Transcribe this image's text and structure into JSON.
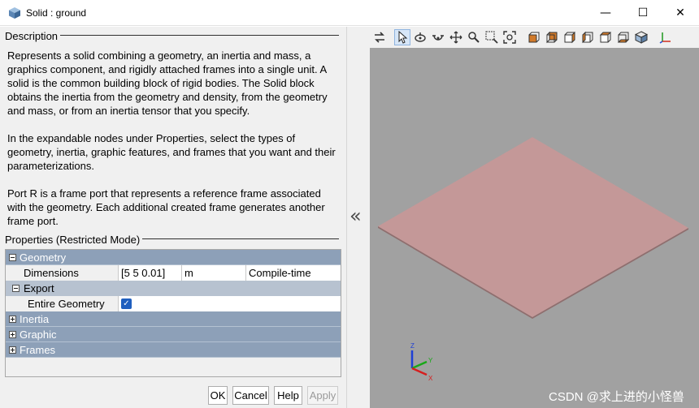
{
  "window": {
    "title": "Solid : ground",
    "minimize_glyph": "—",
    "maximize_glyph": "☐",
    "close_glyph": "✕"
  },
  "description": {
    "heading": "Description",
    "paragraphs": [
      "Represents a solid combining a geometry, an inertia and mass, a graphics component, and rigidly attached frames into a single unit. A solid is the common building block of rigid bodies. The Solid block obtains the inertia from the geometry and density, from the geometry and mass, or from an inertia tensor that you specify.",
      "In the expandable nodes under Properties, select the types of geometry, inertia, graphic features, and frames that you want and their parameterizations.",
      "Port R is a frame port that represents a reference frame associated with the geometry. Each additional created frame generates another frame port."
    ]
  },
  "properties": {
    "heading": "Properties (Restricted Mode)",
    "geometry": {
      "label": "Geometry",
      "expanded": true
    },
    "dimensions": {
      "label": "Dimensions",
      "value": "[5 5 0.01]",
      "unit": "m",
      "mode": "Compile-time"
    },
    "export": {
      "label": "Export",
      "expanded": true
    },
    "entire_geometry": {
      "label": "Entire Geometry",
      "checked": true,
      "check_glyph": "✓"
    },
    "inertia": {
      "label": "Inertia",
      "expanded": false
    },
    "graphic": {
      "label": "Graphic",
      "expanded": false
    },
    "frames": {
      "label": "Frames",
      "expanded": false
    }
  },
  "buttons": {
    "ok": "OK",
    "cancel": "Cancel",
    "help": "Help",
    "apply": "Apply"
  },
  "splitter": {
    "collapse_glyph": "«"
  },
  "viewer": {
    "toolbar_icons": [
      "swap-arrows-icon",
      "select-pointer-icon",
      "rotate-icon",
      "roll-icon",
      "pan-icon",
      "zoom-icon",
      "zoom-box-icon",
      "fit-view-icon",
      "front-view-icon",
      "back-view-icon",
      "left-view-icon",
      "right-view-icon",
      "top-view-icon",
      "bottom-view-icon",
      "isometric-view-icon",
      "frame-axes-icon"
    ],
    "background_color": "#a1a1a1",
    "solid_color": "#c49898",
    "triad": {
      "x": "X",
      "y": "Y",
      "z": "Z"
    }
  },
  "watermark": "CSDN @求上进的小怪兽"
}
